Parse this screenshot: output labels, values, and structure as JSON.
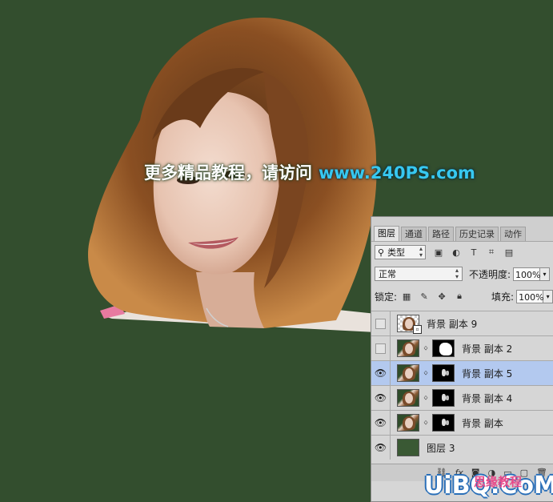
{
  "watermark": {
    "text_cn": "更多精品教程，请访问",
    "url": "www.240PS.com"
  },
  "panel": {
    "tabs": [
      "图层",
      "通道",
      "路径",
      "历史记录",
      "动作"
    ],
    "active_tab": "图层",
    "kind_filter": "类型",
    "blend_mode": "正常",
    "opacity_label": "不透明度:",
    "opacity_value": "100%",
    "lock_label": "锁定:",
    "fill_label": "填充:",
    "fill_value": "100%",
    "filter_icons": [
      "image-filter-icon",
      "adjustment-filter-icon",
      "type-filter-icon",
      "shape-filter-icon",
      "smart-object-filter-icon"
    ],
    "lock_icons": [
      "lock-transparent-icon",
      "lock-pixels-icon",
      "lock-position-icon",
      "lock-all-icon"
    ],
    "layers": [
      {
        "name": "背景 副本 9",
        "visible": false,
        "has_mask": false,
        "smart": true,
        "selected": false
      },
      {
        "name": "背景 副本 2",
        "visible": false,
        "has_mask": true,
        "smart": false,
        "selected": false
      },
      {
        "name": "背景 副本 5",
        "visible": true,
        "has_mask": true,
        "smart": false,
        "selected": true
      },
      {
        "name": "背景 副本 4",
        "visible": true,
        "has_mask": true,
        "smart": false,
        "selected": false
      },
      {
        "name": "背景 副本",
        "visible": true,
        "has_mask": true,
        "smart": false,
        "selected": false
      },
      {
        "name": "图层 3",
        "visible": true,
        "has_mask": false,
        "smart": false,
        "selected": false,
        "fill_color": "#3a5934"
      }
    ],
    "bottom_icons": [
      "link-layers-icon",
      "fx-icon",
      "add-mask-icon",
      "new-adjustment-icon",
      "new-group-icon",
      "new-layer-icon",
      "delete-layer-icon"
    ],
    "bottom_fx_label": "fx"
  },
  "site_logo": {
    "text": "UiBQ.CoM",
    "cn": "思缘教程"
  },
  "colors": {
    "canvas_bg": "#334e2e",
    "panel_bg": "#d6d6d6",
    "selected_row": "#b3c9ef",
    "url_color": "#37c8f0"
  }
}
